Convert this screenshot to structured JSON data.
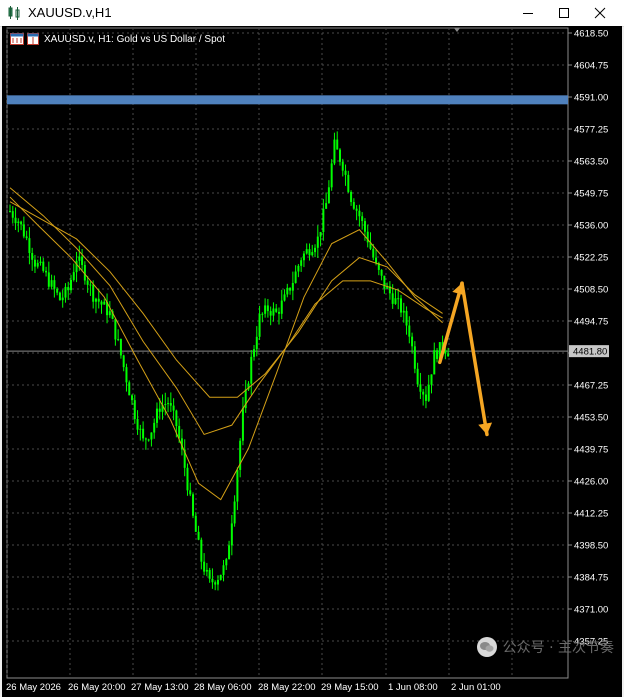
{
  "window": {
    "title": "XAUUSD.v,H1",
    "minimize_icon": "minimize-icon",
    "maximize_icon": "maximize-icon",
    "close_icon": "close-icon"
  },
  "chart_header": {
    "text": "XAUUSD.v, H1:  Gold vs US Dollar / Spot"
  },
  "watermark": {
    "text": "公众号 · 主次节奏"
  },
  "colors": {
    "background": "#000000",
    "candle": "#00ff00",
    "grid": "#4a4a4a",
    "axis_text": "#ffffff",
    "resistance": "#4f81bd",
    "ma": "#d4a017",
    "arrow": "#f5a623",
    "current_price_line": "#8a8a8a"
  },
  "chart_data": {
    "type": "candlestick",
    "symbol": "XAUUSD.v",
    "timeframe": "H1",
    "y_ticks": [
      "4618.50",
      "4604.75",
      "4591.00",
      "4577.25",
      "4563.50",
      "4549.75",
      "4536.00",
      "4522.25",
      "4508.50",
      "4494.75",
      "4481.00",
      "4467.25",
      "4453.50",
      "4439.75",
      "4426.00",
      "4412.25",
      "4398.50",
      "4384.75",
      "4371.00",
      "4357.25"
    ],
    "ylim": [
      4350.0,
      4621.0
    ],
    "x_ticks": [
      "26 May 2026",
      "26 May 20:00",
      "27 May 13:00",
      "28 May 06:00",
      "28 May 22:00",
      "29 May 15:00",
      "1 Jun 08:00",
      "2 Jun 01:00"
    ],
    "current_price": "4481.80",
    "resistance_level": 4590.0,
    "close_path": [
      [
        0,
        4542
      ],
      [
        3,
        4538
      ],
      [
        6,
        4530
      ],
      [
        9,
        4520
      ],
      [
        12,
        4516
      ],
      [
        15,
        4510
      ],
      [
        18,
        4504
      ],
      [
        21,
        4508
      ],
      [
        24,
        4522
      ],
      [
        27,
        4515
      ],
      [
        30,
        4506
      ],
      [
        33,
        4502
      ],
      [
        36,
        4498
      ],
      [
        39,
        4485
      ],
      [
        42,
        4470
      ],
      [
        45,
        4455
      ],
      [
        48,
        4443
      ],
      [
        51,
        4448
      ],
      [
        54,
        4458
      ],
      [
        57,
        4460
      ],
      [
        60,
        4450
      ],
      [
        63,
        4432
      ],
      [
        66,
        4410
      ],
      [
        69,
        4392
      ],
      [
        72,
        4382
      ],
      [
        75,
        4385
      ],
      [
        78,
        4390
      ],
      [
        81,
        4420
      ],
      [
        84,
        4455
      ],
      [
        87,
        4478
      ],
      [
        90,
        4496
      ],
      [
        93,
        4500
      ],
      [
        96,
        4498
      ],
      [
        99,
        4504
      ],
      [
        102,
        4512
      ],
      [
        105,
        4522
      ],
      [
        108,
        4526
      ],
      [
        111,
        4530
      ],
      [
        114,
        4545
      ],
      [
        117,
        4570
      ],
      [
        120,
        4562
      ],
      [
        123,
        4548
      ],
      [
        126,
        4540
      ],
      [
        129,
        4530
      ],
      [
        132,
        4518
      ],
      [
        135,
        4510
      ],
      [
        138,
        4505
      ],
      [
        141,
        4500
      ],
      [
        144,
        4490
      ],
      [
        147,
        4470
      ],
      [
        150,
        4462
      ],
      [
        153,
        4480
      ],
      [
        156,
        4484
      ],
      [
        158,
        4482
      ]
    ],
    "ma_fast": [
      [
        0,
        4548
      ],
      [
        10,
        4536
      ],
      [
        22,
        4522
      ],
      [
        34,
        4505
      ],
      [
        46,
        4478
      ],
      [
        58,
        4452
      ],
      [
        68,
        4425
      ],
      [
        76,
        4418
      ],
      [
        86,
        4440
      ],
      [
        96,
        4472
      ],
      [
        106,
        4505
      ],
      [
        116,
        4528
      ],
      [
        126,
        4534
      ],
      [
        136,
        4520
      ],
      [
        146,
        4505
      ],
      [
        156,
        4494
      ]
    ],
    "ma_mid": [
      [
        0,
        4552
      ],
      [
        12,
        4540
      ],
      [
        24,
        4526
      ],
      [
        36,
        4510
      ],
      [
        48,
        4486
      ],
      [
        60,
        4466
      ],
      [
        70,
        4446
      ],
      [
        80,
        4450
      ],
      [
        90,
        4468
      ],
      [
        100,
        4484
      ],
      [
        110,
        4502
      ],
      [
        120,
        4512
      ],
      [
        130,
        4512
      ],
      [
        140,
        4508
      ],
      [
        150,
        4500
      ],
      [
        156,
        4496
      ]
    ],
    "ma_slow": [
      [
        0,
        4546
      ],
      [
        12,
        4538
      ],
      [
        24,
        4530
      ],
      [
        36,
        4516
      ],
      [
        48,
        4498
      ],
      [
        60,
        4478
      ],
      [
        72,
        4462
      ],
      [
        82,
        4462
      ],
      [
        92,
        4472
      ],
      [
        104,
        4490
      ],
      [
        116,
        4512
      ],
      [
        126,
        4522
      ],
      [
        136,
        4518
      ],
      [
        146,
        4506
      ],
      [
        156,
        4498
      ]
    ],
    "annotations": [
      {
        "type": "arrow",
        "from": [
          155,
          4477
        ],
        "to": [
          163,
          4511
        ]
      },
      {
        "type": "arrow",
        "from": [
          163,
          4511
        ],
        "to": [
          172,
          4446
        ]
      }
    ]
  }
}
